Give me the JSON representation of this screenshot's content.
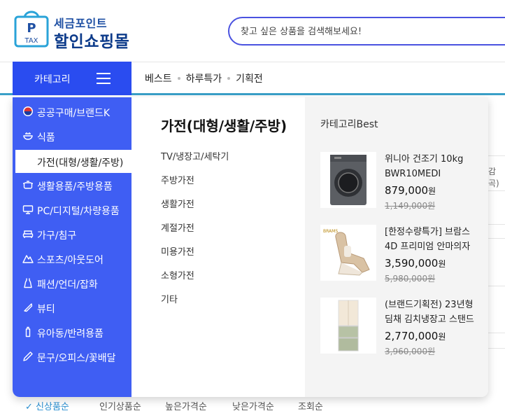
{
  "logo": {
    "badge_letter": "P",
    "badge_text": "TAX",
    "line1": "세금포인트",
    "line2": "할인쇼핑몰",
    "colors": {
      "primary": "#1e4fa3",
      "dark": "#0d3b8a",
      "accent": "#2aa3d8"
    }
  },
  "search": {
    "placeholder": "찾고 싶은 상품을 검색해보세요!",
    "value": ""
  },
  "nav": {
    "category_label": "카테고리",
    "links": [
      "베스트",
      "하루특가",
      "기획전"
    ]
  },
  "categories": [
    {
      "label": "공공구매/브랜드K",
      "icon": "korea-flag-icon"
    },
    {
      "label": "식품",
      "icon": "food-bowl-icon"
    },
    {
      "label": "생활용품/주방용품",
      "icon": "pot-icon"
    },
    {
      "label": "PC/디지털/차량용품",
      "icon": "monitor-icon"
    },
    {
      "label": "가구/침구",
      "icon": "sofa-icon"
    },
    {
      "label": "스포츠/아웃도어",
      "icon": "mountain-icon"
    },
    {
      "label": "패션/언더/잡화",
      "icon": "dress-icon"
    },
    {
      "label": "뷰티",
      "icon": "lipstick-icon"
    },
    {
      "label": "유아동/반려용품",
      "icon": "baby-bottle-icon"
    },
    {
      "label": "문구/오피스/꽃배달",
      "icon": "pen-icon"
    }
  ],
  "selected_subcategory": "가전(대형/생활/주방)",
  "middle": {
    "title": "가전(대형/생활/주방)",
    "items": [
      "TV/냉장고/세탁기",
      "주방가전",
      "생활가전",
      "계절가전",
      "미용가전",
      "소형가전",
      "기타"
    ]
  },
  "best": {
    "title": "카테고리Best",
    "currency": "원",
    "products": [
      {
        "name": "위니아 건조기 10kg BWR10MEDI",
        "price": "879,000",
        "original_price": "1,149,000원",
        "image": "dryer-image"
      },
      {
        "name": "[한정수량특가] 브람스 4D 프리미엄 안마의자",
        "price": "3,590,000",
        "original_price": "5,980,000원",
        "image": "massage-chair-image",
        "brand_tag": "BRAMS"
      },
      {
        "name": "(브랜드기획전) 23년형 딤채 김치냉장고 스탠드",
        "price": "2,770,000",
        "original_price": "3,960,000원",
        "image": "kimchi-fridge-image"
      }
    ]
  },
  "background": {
    "frag1": "감곡)",
    "sort_options": [
      "신상품순",
      "인기상품순",
      "높은가격순",
      "낮은가격순",
      "조회순"
    ],
    "active_sort": "신상품순",
    "colors": {
      "active_sort": "#2a8fd0",
      "category_bg": "#3f5ef3",
      "category_btn": "#2a4cf0",
      "nav_underline": "#3aa0c8"
    }
  }
}
